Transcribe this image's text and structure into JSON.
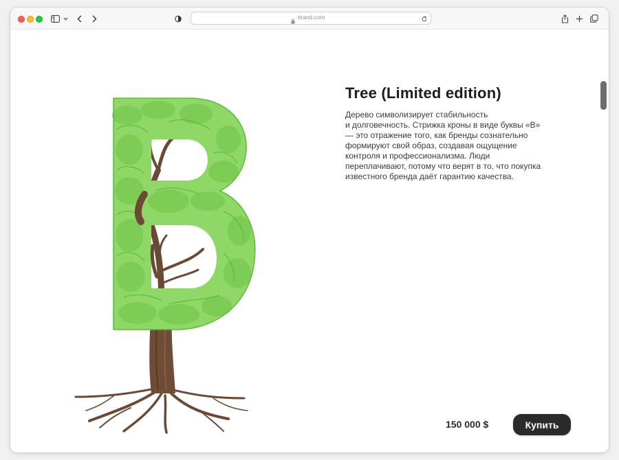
{
  "browser": {
    "url": "brand.com",
    "icons": {
      "sidebar": "sidebar-icon",
      "chevron": "chevron-down-icon",
      "back": "back-arrow-icon",
      "forward": "forward-arrow-icon",
      "privacy": "shield-icon",
      "lock": "lock-icon",
      "reload": "reload-icon",
      "share": "share-icon",
      "new_tab": "plus-icon",
      "tabs": "tabs-overview-icon"
    }
  },
  "product": {
    "title": "Tree (Limited edition)",
    "description_lines": [
      "Дерево символизирует стабильность",
      "и долговечность. Стрижка кроны в виде буквы «В»",
      "— это отражение того, как бренды сознательно",
      "формируют свой образ, создавая ощущение",
      "контроля и профессионализма. Люди",
      "переплачивают, потому что верят в то, что покупка",
      "известного бренда даёт гарантию качества."
    ],
    "price": "150 000 $",
    "buy_label": "Купить"
  },
  "colors": {
    "foliage": "#8fd868",
    "foliage_dark": "#5fb83a",
    "trunk": "#6b4a35",
    "button": "#2b2b2b"
  }
}
